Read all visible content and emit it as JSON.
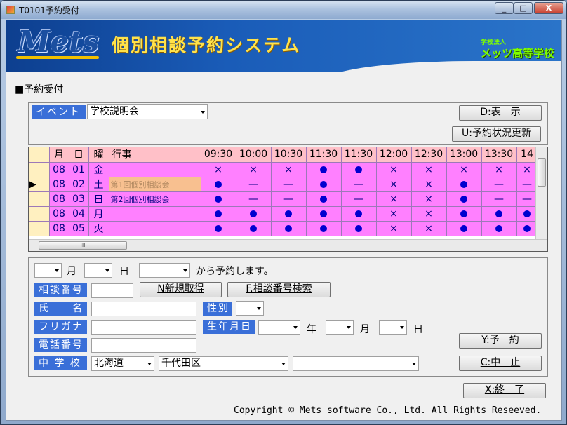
{
  "window": {
    "title": "T0101予約受付",
    "min": "_",
    "max": "□",
    "close": "X"
  },
  "header": {
    "logo": "Mets",
    "system_title": "個別相談予約システム",
    "school_sub": "学校法人",
    "school_name": "メッツ高等学校"
  },
  "section": {
    "label": "■予約受付"
  },
  "event": {
    "label": "イベント",
    "selected": "学校説明会"
  },
  "buttons": {
    "display": "D:表　示",
    "refresh": "U:予約状況更新",
    "new_no": "N新規取得",
    "search_no": "F.相談番号検索",
    "reserve": "Y:予　約",
    "cancel": "C:中　止",
    "exit": "X:終　了"
  },
  "grid": {
    "headers": [
      "月",
      "日",
      "曜",
      "行事",
      "09:30",
      "10:00",
      "10:30",
      "11:30",
      "11:30",
      "12:00",
      "12:30",
      "13:00",
      "13:30",
      "14"
    ],
    "rows": [
      {
        "current": "",
        "m": "08",
        "d": "01",
        "w": "金",
        "event": "",
        "slots": [
          "×",
          "×",
          "×",
          "●",
          "●",
          "×",
          "×",
          "×",
          "×",
          "×"
        ]
      },
      {
        "current": "▶",
        "m": "08",
        "d": "02",
        "w": "土",
        "event": "第1回個別相談会",
        "slots": [
          "●",
          "—",
          "—",
          "●",
          "—",
          "×",
          "×",
          "●",
          "—",
          "—"
        ]
      },
      {
        "current": "",
        "m": "08",
        "d": "03",
        "w": "日",
        "event": "第2回個別相談会",
        "slots": [
          "●",
          "—",
          "—",
          "●",
          "—",
          "×",
          "×",
          "●",
          "—",
          "—"
        ]
      },
      {
        "current": "",
        "m": "08",
        "d": "04",
        "w": "月",
        "event": "",
        "slots": [
          "●",
          "●",
          "●",
          "●",
          "●",
          "×",
          "×",
          "●",
          "●",
          "●"
        ]
      },
      {
        "current": "",
        "m": "08",
        "d": "05",
        "w": "火",
        "event": "",
        "slots": [
          "●",
          "●",
          "●",
          "●",
          "●",
          "×",
          "×",
          "●",
          "●",
          "●"
        ]
      }
    ],
    "hscroll_grip": "III"
  },
  "form": {
    "month_unit": "月",
    "day_unit": "日",
    "reserve_suffix": "から予約します。",
    "consult_no_label": "相談番号",
    "name_label": "氏　　名",
    "gender_label": "性別",
    "kana_label": "フリガナ",
    "birthdate_label": "生年月日",
    "year_unit": "年",
    "bmonth_unit": "月",
    "bday_unit": "日",
    "phone_label": "電話番号",
    "school_label": "中 学 校",
    "pref": "北海道",
    "city": "千代田区"
  },
  "footer": {
    "copyright": "Copyright © Mets software Co., Ltd. All Rights Reseeved."
  }
}
